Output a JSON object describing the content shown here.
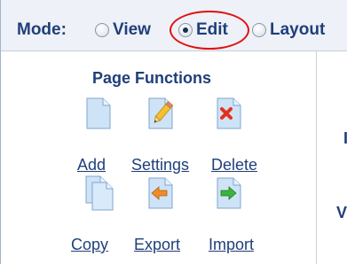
{
  "mode_bar": {
    "label": "Mode:",
    "options": [
      {
        "label": "View",
        "selected": false
      },
      {
        "label": "Edit",
        "selected": true
      },
      {
        "label": "Layout",
        "selected": false
      }
    ],
    "highlight_color": "#e01010"
  },
  "page_functions": {
    "title": "Page Functions",
    "items": [
      {
        "label": "Add",
        "icon": "page-blank-icon"
      },
      {
        "label": "Settings",
        "icon": "page-pencil-icon"
      },
      {
        "label": "Delete",
        "icon": "page-delete-icon"
      },
      {
        "label": "Copy",
        "icon": "page-copy-icon"
      },
      {
        "label": "Export",
        "icon": "page-export-icon"
      },
      {
        "label": "Import",
        "icon": "page-import-icon"
      }
    ]
  },
  "right_panel": {
    "fragments": [
      "I",
      "V"
    ]
  },
  "colors": {
    "text": "#1f3f7a",
    "modebar_bg": "#eef1f7",
    "border": "#c5cfdc"
  }
}
